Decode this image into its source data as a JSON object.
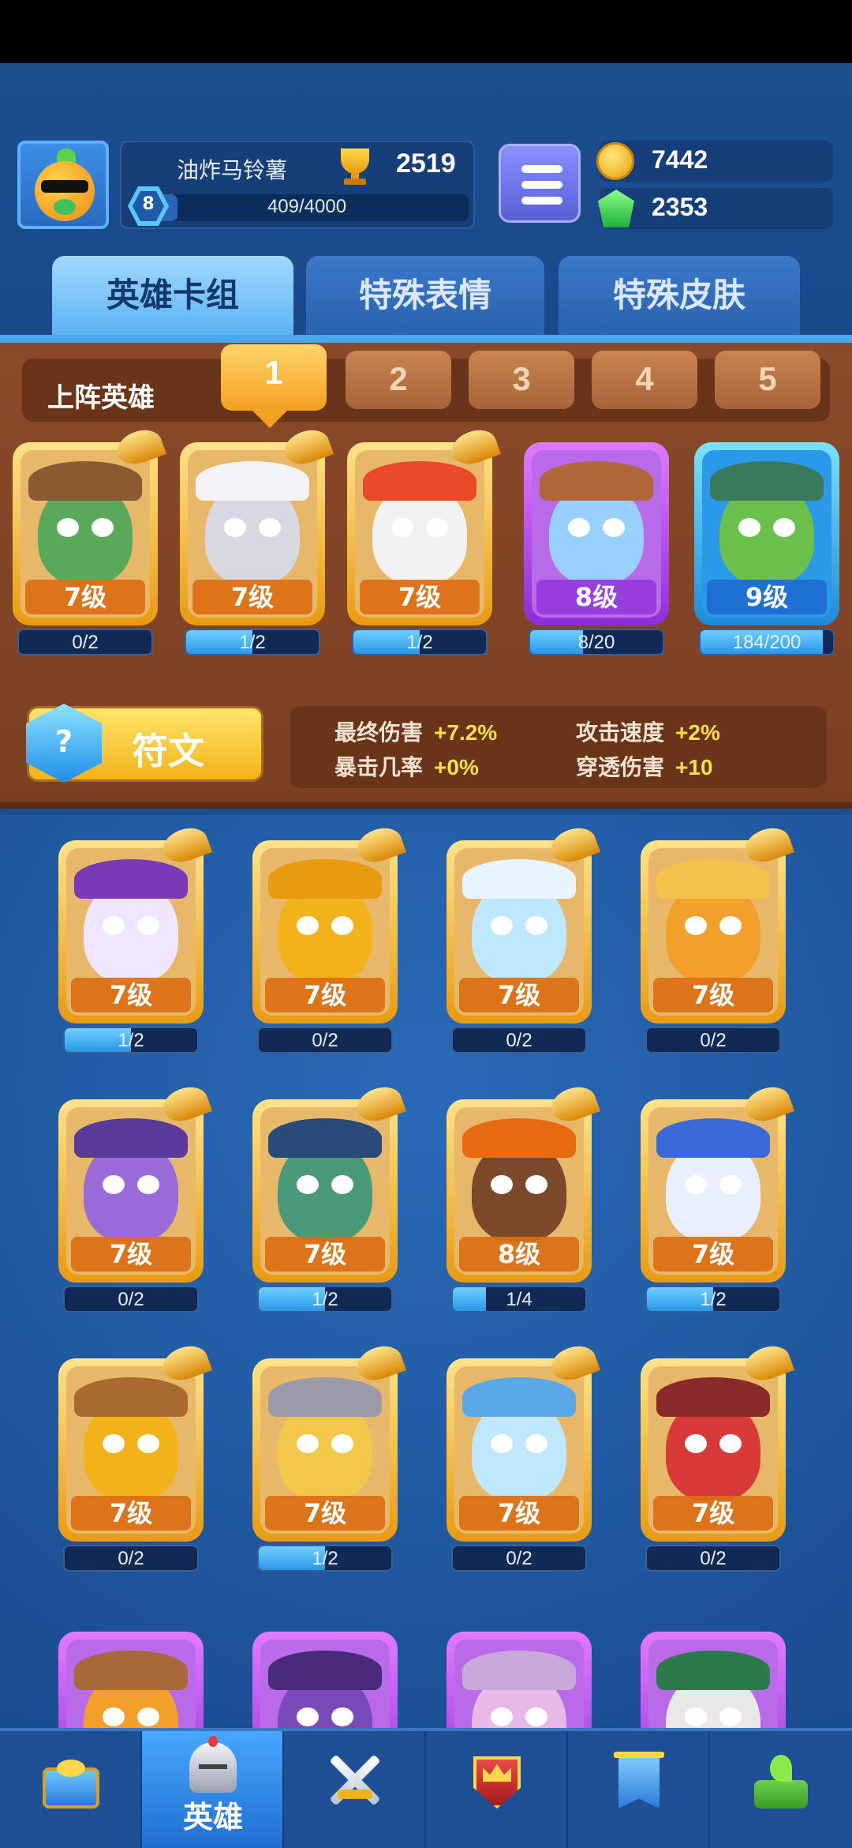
{
  "player": {
    "name": "油炸马铃薯",
    "level": "8",
    "trophies": "2519",
    "xp": "409/4000",
    "xp_fraction": 0.1
  },
  "currency": {
    "coins": "7442",
    "gems": "2353"
  },
  "tabs": [
    {
      "label": "英雄卡组",
      "active": true
    },
    {
      "label": "特殊表情",
      "active": false
    },
    {
      "label": "特殊皮肤",
      "active": false
    }
  ],
  "lineup": {
    "title": "上阵英雄",
    "slots": [
      "1",
      "2",
      "3",
      "4",
      "5"
    ],
    "active_slot": 0,
    "heroes": [
      {
        "level": "7级",
        "progress": "0/2",
        "fill": 0.0,
        "rarity": "gold",
        "color": "#5aa85a",
        "hat": "#8a5a30"
      },
      {
        "level": "7级",
        "progress": "1/2",
        "fill": 0.5,
        "rarity": "gold",
        "color": "#d8d8e0",
        "hat": "#f4f4f8"
      },
      {
        "level": "7级",
        "progress": "1/2",
        "fill": 0.5,
        "rarity": "gold",
        "color": "#f2f2f2",
        "hat": "#e84a2a"
      },
      {
        "level": "8级",
        "progress": "8/20",
        "fill": 0.4,
        "rarity": "purple",
        "color": "#9ad0ff",
        "hat": "#b0683a"
      },
      {
        "level": "9级",
        "progress": "184/200",
        "fill": 0.92,
        "rarity": "blue",
        "color": "#6ac04a",
        "hat": "#3a7a5a"
      }
    ]
  },
  "rune": {
    "label": "符文"
  },
  "stats": [
    {
      "name": "最终伤害",
      "value": "+7.2%"
    },
    {
      "name": "攻击速度",
      "value": "+2%"
    },
    {
      "name": "暴击几率",
      "value": "+0%"
    },
    {
      "name": "穿透伤害",
      "value": "+10"
    }
  ],
  "collection": [
    {
      "level": "7级",
      "progress": "1/2",
      "fill": 0.5,
      "color": "#f0e6ff",
      "hat": "#7a3ab8"
    },
    {
      "level": "7级",
      "progress": "0/2",
      "fill": 0.0,
      "color": "#f2b21a",
      "hat": "#e89a10"
    },
    {
      "level": "7级",
      "progress": "0/2",
      "fill": 0.0,
      "color": "#bfe8ff",
      "hat": "#e8f4ff"
    },
    {
      "level": "7级",
      "progress": "0/2",
      "fill": 0.0,
      "color": "#f2a02a",
      "hat": "#f2c24a"
    },
    {
      "level": "7级",
      "progress": "0/2",
      "fill": 0.0,
      "color": "#9a6ad8",
      "hat": "#5a3a9a"
    },
    {
      "level": "7级",
      "progress": "1/2",
      "fill": 0.5,
      "color": "#4a9a7a",
      "hat": "#2a4a7a"
    },
    {
      "level": "8级",
      "progress": "1/4",
      "fill": 0.25,
      "color": "#7a4a2a",
      "hat": "#e86a10"
    },
    {
      "level": "7级",
      "progress": "1/2",
      "fill": 0.5,
      "color": "#e8f0ff",
      "hat": "#3a6ad8"
    },
    {
      "level": "7级",
      "progress": "0/2",
      "fill": 0.0,
      "color": "#f2b21a",
      "hat": "#a86a30"
    },
    {
      "level": "7级",
      "progress": "1/2",
      "fill": 0.5,
      "color": "#f2c84a",
      "hat": "#9a9aa8"
    },
    {
      "level": "7级",
      "progress": "0/2",
      "fill": 0.0,
      "color": "#bfe8ff",
      "hat": "#5aa8e8"
    },
    {
      "level": "7级",
      "progress": "0/2",
      "fill": 0.0,
      "color": "#d83a3a",
      "hat": "#8a2a2a"
    }
  ],
  "collection_partial": [
    {
      "color": "#f2a02a",
      "hat": "#a8683a"
    },
    {
      "color": "#7a4ab8",
      "hat": "#4a2a7a"
    },
    {
      "color": "#e8b8e8",
      "hat": "#c8a8d8"
    },
    {
      "color": "#e8e8e8",
      "hat": "#2a7a4a"
    }
  ],
  "nav": [
    {
      "icon": "treasure-chest-icon",
      "label": "",
      "active": false
    },
    {
      "icon": "knight-helmet-icon",
      "label": "英雄",
      "active": true
    },
    {
      "icon": "crossed-swords-icon",
      "label": "",
      "active": false
    },
    {
      "icon": "crown-shield-icon",
      "label": "",
      "active": false
    },
    {
      "icon": "guild-banner-icon",
      "label": "",
      "active": false
    },
    {
      "icon": "sprout-island-icon",
      "label": "",
      "active": false
    }
  ]
}
